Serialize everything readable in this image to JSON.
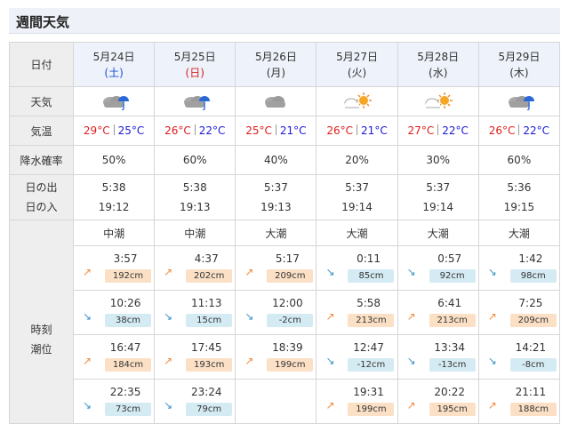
{
  "title": "週間天気",
  "labels": {
    "date": "日付",
    "weather": "天気",
    "temp": "気温",
    "rain": "降水確率",
    "sunrise": "日の出",
    "sunset": "日の入",
    "tide_time": "時刻",
    "tide_level": "潮位"
  },
  "days": [
    {
      "date": "5月24日",
      "dow": "(土)",
      "dow_type": "sat",
      "weather": "cloud-rain-icon",
      "hi": "29°C",
      "lo": "25°C",
      "rain": "50%",
      "sunrise": "5:38",
      "sunset": "19:12",
      "tide_type": "中潮",
      "tides": [
        {
          "time": "3:57",
          "level": "192cm",
          "dir": "up"
        },
        {
          "time": "10:26",
          "level": "38cm",
          "dir": "down"
        },
        {
          "time": "16:47",
          "level": "184cm",
          "dir": "up"
        },
        {
          "time": "22:35",
          "level": "73cm",
          "dir": "down"
        }
      ]
    },
    {
      "date": "5月25日",
      "dow": "(日)",
      "dow_type": "sun",
      "weather": "cloud-rain-icon",
      "hi": "26°C",
      "lo": "22°C",
      "rain": "60%",
      "sunrise": "5:38",
      "sunset": "19:13",
      "tide_type": "中潮",
      "tides": [
        {
          "time": "4:37",
          "level": "202cm",
          "dir": "up"
        },
        {
          "time": "11:13",
          "level": "15cm",
          "dir": "down"
        },
        {
          "time": "17:45",
          "level": "193cm",
          "dir": "up"
        },
        {
          "time": "23:24",
          "level": "79cm",
          "dir": "down"
        }
      ]
    },
    {
      "date": "5月26日",
      "dow": "(月)",
      "dow_type": "week",
      "weather": "cloud-icon",
      "hi": "25°C",
      "lo": "21°C",
      "rain": "40%",
      "sunrise": "5:37",
      "sunset": "19:13",
      "tide_type": "大潮",
      "tides": [
        {
          "time": "5:17",
          "level": "209cm",
          "dir": "up"
        },
        {
          "time": "12:00",
          "level": "-2cm",
          "dir": "down"
        },
        {
          "time": "18:39",
          "level": "199cm",
          "dir": "up"
        },
        {
          "time": "",
          "level": "",
          "dir": ""
        }
      ]
    },
    {
      "date": "5月27日",
      "dow": "(火)",
      "dow_type": "week",
      "weather": "cloud-sun-icon",
      "hi": "26°C",
      "lo": "21°C",
      "rain": "20%",
      "sunrise": "5:37",
      "sunset": "19:14",
      "tide_type": "大潮",
      "tides": [
        {
          "time": "0:11",
          "level": "85cm",
          "dir": "down"
        },
        {
          "time": "5:58",
          "level": "213cm",
          "dir": "up"
        },
        {
          "time": "12:47",
          "level": "-12cm",
          "dir": "down"
        },
        {
          "time": "19:31",
          "level": "199cm",
          "dir": "up"
        }
      ]
    },
    {
      "date": "5月28日",
      "dow": "(水)",
      "dow_type": "week",
      "weather": "cloud-sun-icon",
      "hi": "27°C",
      "lo": "22°C",
      "rain": "30%",
      "sunrise": "5:37",
      "sunset": "19:14",
      "tide_type": "大潮",
      "tides": [
        {
          "time": "0:57",
          "level": "92cm",
          "dir": "down"
        },
        {
          "time": "6:41",
          "level": "213cm",
          "dir": "up"
        },
        {
          "time": "13:34",
          "level": "-13cm",
          "dir": "down"
        },
        {
          "time": "20:22",
          "level": "195cm",
          "dir": "up"
        }
      ]
    },
    {
      "date": "5月29日",
      "dow": "(木)",
      "dow_type": "week",
      "weather": "cloud-rain-icon",
      "hi": "26°C",
      "lo": "22°C",
      "rain": "60%",
      "sunrise": "5:36",
      "sunset": "19:15",
      "tide_type": "大潮",
      "tides": [
        {
          "time": "1:42",
          "level": "98cm",
          "dir": "down"
        },
        {
          "time": "7:25",
          "level": "209cm",
          "dir": "up"
        },
        {
          "time": "14:21",
          "level": "-8cm",
          "dir": "down"
        },
        {
          "time": "21:11",
          "level": "188cm",
          "dir": "up"
        }
      ]
    }
  ],
  "colors": {
    "high": "#e01b1b",
    "low": "#1a1ad6",
    "tide_up": "#f08a3c",
    "tide_down": "#3a95c9",
    "header_bg": "#eef2fa",
    "label_bg": "#eeeeee"
  }
}
